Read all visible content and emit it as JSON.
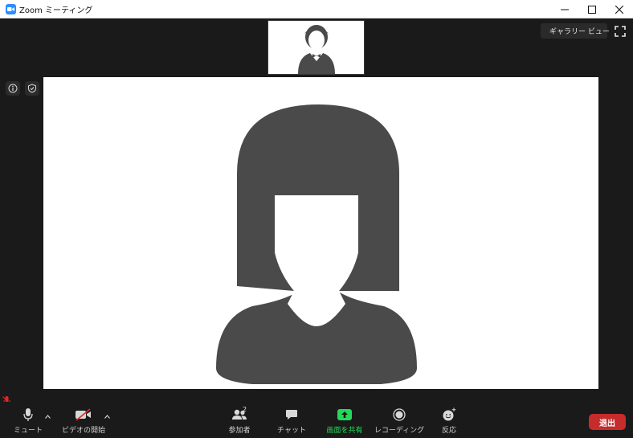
{
  "window": {
    "title": "Zoom ミーティング",
    "controls": [
      "minimize-icon",
      "maximize-icon",
      "close-icon"
    ]
  },
  "view": {
    "gallery_label": "ギャラリー ビュー"
  },
  "participants": {
    "count": "2"
  },
  "toolbar": {
    "mute_label": "ミュート",
    "video_label": "ビデオの開始",
    "participants_label": "参加者",
    "chat_label": "チャット",
    "share_label": "画面を共有",
    "record_label": "レコーディング",
    "reactions_label": "反応",
    "leave_label": "退出"
  },
  "colors": {
    "background": "#1a1a1a",
    "share_accent": "#23d959",
    "leave_red": "#c72c2c",
    "zoom_blue": "#2d8cff",
    "avatar_gray": "#4a4a4a",
    "muted_red": "#e02828"
  }
}
